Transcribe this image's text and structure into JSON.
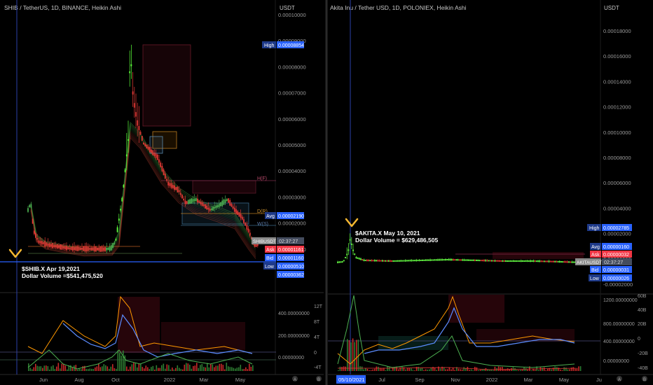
{
  "left": {
    "header": "SHIB / TetherUS, 1D, BINANCE, Heikin Ashi",
    "currency": "USDT",
    "y_ticks": [
      "0.00010000",
      "0.00009000",
      "0.00008000",
      "0.00007000",
      "0.00006000",
      "0.00005000",
      "0.00004000",
      "0.00003000",
      "0.00002000",
      "0.00001000"
    ],
    "x_ticks": [
      "Jun",
      "Aug",
      "Oct",
      "2022",
      "Mar",
      "May"
    ],
    "badges": {
      "high_label": "High",
      "high_value": "0.00008854",
      "avg_label": "Avg",
      "avg_value": "0.00002190",
      "symbol": "SHIBUSDT",
      "countdown": "02:37:27",
      "ask_label": "Ask",
      "ask_value": "0.00001161",
      "bid_label": "Bid",
      "bid_value": "0.00001160",
      "low_label": "Low",
      "low_value": "0.00000510",
      "last_value": "0.00000362"
    },
    "annotation": {
      "line1": "$SHIB.X Apr 19,2021",
      "line2": "Dollar Volume =$541,475,520"
    },
    "levels": {
      "h": "H(F)",
      "d": "D(R)",
      "w": "W(S)"
    },
    "ind_ticks": [
      "400.00000000",
      "200.00000000",
      "0.00000000"
    ],
    "ind_ticks2": [
      "12T",
      "8T",
      "4T",
      "0",
      "-4T"
    ]
  },
  "right": {
    "header": "Akita Inu / Tether USD, 1D, POLONIEX, Heikin Ashi",
    "currency": "USDT",
    "y_ticks": [
      "0.00018000",
      "0.00016000",
      "0.00014000",
      "0.00012000",
      "0.00010000",
      "0.00008000",
      "0.00006000",
      "0.00004000",
      "0.00002000",
      "0.00000000",
      "-0.00002000"
    ],
    "x_ticks": [
      "Jul",
      "Sep",
      "Nov",
      "2022",
      "Mar",
      "May",
      "Ju"
    ],
    "x_highlight": "05/10/2021",
    "badges": {
      "high_label": "High",
      "high_value": "0.00002785",
      "avg_label": "Avg",
      "avg_value": "0.00000160",
      "ask_label": "Ask",
      "ask_value": "0.00000032",
      "symbol": "AKITAUSDT",
      "countdown": "02:37:27",
      "bid_label": "Bid",
      "bid_value": "0.00000031",
      "low_label": "Low",
      "low_value": "0.00000026"
    },
    "annotation": {
      "line1": "$AKITA.X May 10, 2021",
      "line2": "Dollar Volume = $629,486,505"
    },
    "ind_ticks": [
      "1200.00000000",
      "800.00000000",
      "400.00000000",
      "0.00000000"
    ],
    "ind_ticks2": [
      "60B",
      "40B",
      "20B",
      "0",
      "-20B",
      "-40B"
    ]
  },
  "colors": {
    "up": "#4caf50",
    "up_bright": "#66ff44",
    "down": "#e53935",
    "bid": "#2962ff",
    "ask": "#f23645",
    "avg": "#1e3a8a",
    "orange": "#ff9800",
    "marker": "#f5b731"
  },
  "chart_data": [
    {
      "type": "candlestick",
      "title": "SHIB / TetherUS, 1D, BINANCE, Heikin Ashi",
      "ylabel": "USDT",
      "ylim": [
        3.6e-06,
        0.0001
      ],
      "x": [
        "2021-05",
        "2021-06",
        "2021-07",
        "2021-08",
        "2021-09",
        "2021-10",
        "2021-10-28",
        "2021-11",
        "2021-12",
        "2022-01",
        "2022-02",
        "2022-03",
        "2022-04",
        "2022-05"
      ],
      "close": [
        1.1e-05,
        8.5e-06,
        7.2e-06,
        6.8e-06,
        7.4e-06,
        2.5e-05,
        8.85e-05,
        4.8e-05,
        3.4e-05,
        3e-05,
        2.8e-05,
        2.5e-05,
        2.4e-05,
        1.16e-05
      ],
      "annotations": [
        {
          "date": "2021-04-19",
          "text": "$SHIB.X Apr 19,2021 Dollar Volume =$541,475,520"
        }
      ],
      "high": 8.854e-05,
      "avg": 2.19e-05,
      "ask": 1.161e-05,
      "bid": 1.16e-05,
      "low": 5.1e-06
    },
    {
      "type": "candlestick",
      "title": "Akita Inu / Tether USD, 1D, POLONIEX, Heikin Ashi",
      "ylabel": "USDT",
      "ylim": [
        -2e-05,
        0.00019
      ],
      "x": [
        "2021-05-10",
        "2021-06",
        "2021-07",
        "2021-08",
        "2021-09",
        "2021-10",
        "2021-11",
        "2021-12",
        "2022-01",
        "2022-02",
        "2022-03",
        "2022-04",
        "2022-05"
      ],
      "close": [
        2.785e-05,
        6e-06,
        3e-06,
        2.5e-06,
        2e-06,
        2.2e-06,
        2.1e-06,
        1.7e-06,
        1.5e-06,
        1.2e-06,
        1e-06,
        8e-07,
        3.2e-07
      ],
      "annotations": [
        {
          "date": "2021-05-10",
          "text": "$AKITA.X May 10, 2021 Dollar Volume = $629,486,505"
        }
      ],
      "high": 2.785e-05,
      "avg": 1.6e-06,
      "ask": 3.2e-07,
      "bid": 3.1e-07,
      "low": 2.6e-07
    }
  ]
}
